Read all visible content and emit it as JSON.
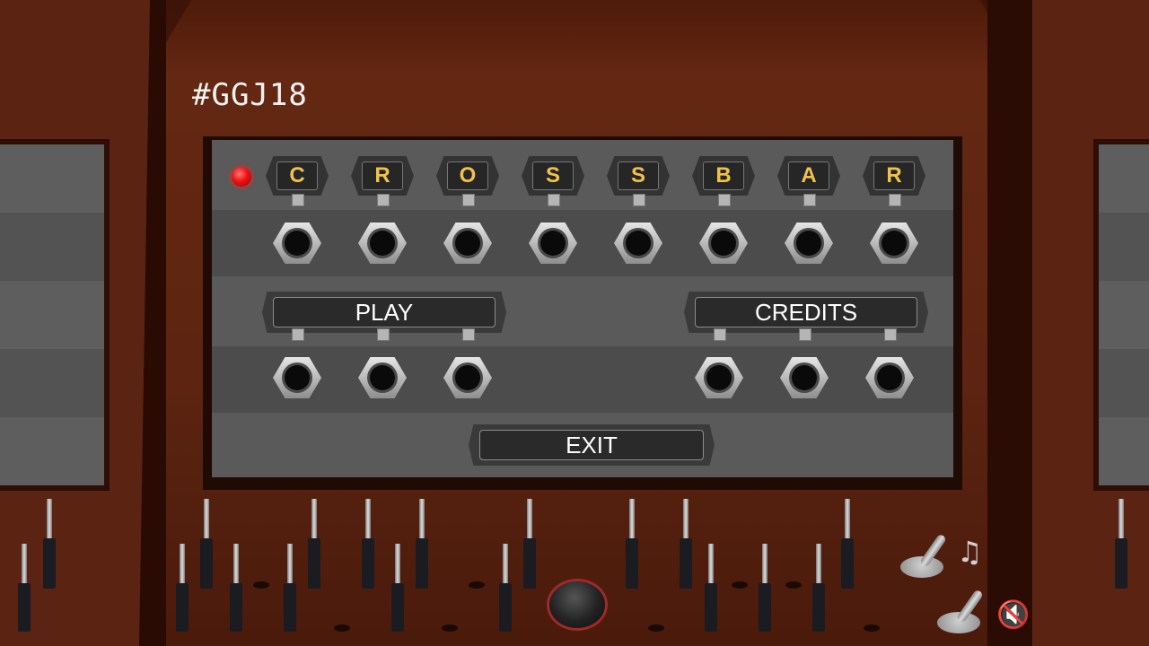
{
  "header": {
    "hashtag": "#GGJ18"
  },
  "title_letters": [
    "C",
    "R",
    "O",
    "S",
    "S",
    "B",
    "A",
    "R"
  ],
  "menu": {
    "play_label": "PLAY",
    "credits_label": "CREDITS",
    "exit_label": "EXIT"
  },
  "controls": {
    "music_icon": "music-note-icon",
    "mute_icon": "speaker-mute-icon"
  },
  "colors": {
    "letter": "#f1c24a",
    "led": "#ee1111",
    "wood": "#5c2411"
  }
}
